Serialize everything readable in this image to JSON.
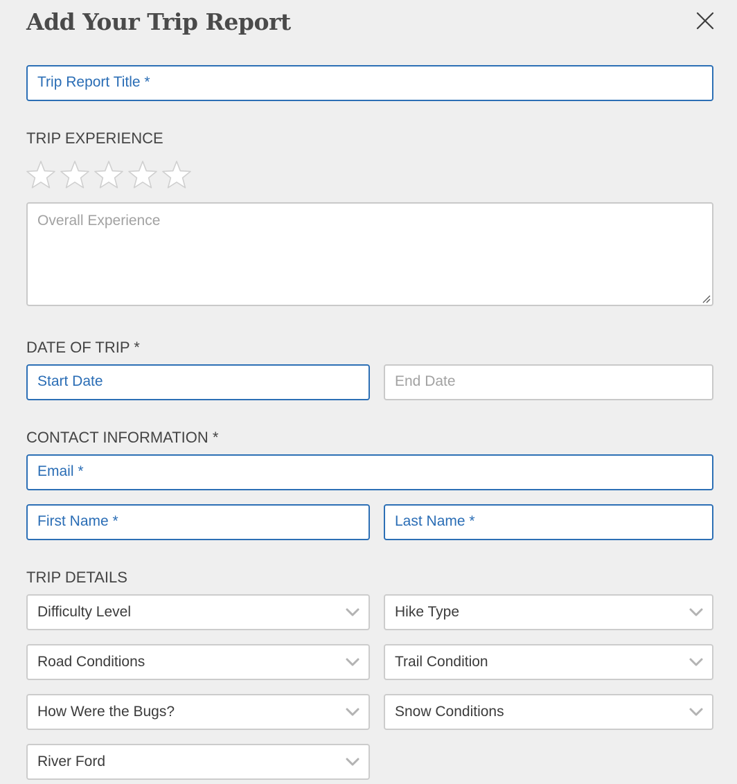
{
  "header": {
    "title": "Add Your Trip Report",
    "close_icon": "close-icon"
  },
  "fields": {
    "trip_title_placeholder": "Trip Report Title *",
    "overall_experience_placeholder": "Overall Experience",
    "start_date_placeholder": "Start Date",
    "end_date_placeholder": "End Date",
    "email_placeholder": "Email *",
    "first_name_placeholder": "First Name *",
    "last_name_placeholder": "Last Name *"
  },
  "sections": {
    "trip_experience": "TRIP EXPERIENCE",
    "date_of_trip": "DATE OF TRIP *",
    "contact_information": "CONTACT INFORMATION *",
    "trip_details": "TRIP DETAILS"
  },
  "rating": {
    "max_stars": 5,
    "selected": 0,
    "star_icon": "star-outline-icon"
  },
  "trip_details": {
    "difficulty_level": "Difficulty Level",
    "hike_type": "Hike Type",
    "road_conditions": "Road Conditions",
    "trail_condition": "Trail Condition",
    "bugs": "How Were the Bugs?",
    "snow_conditions": "Snow Conditions",
    "river_ford": "River Ford",
    "chevron_icon": "chevron-down-icon"
  },
  "colors": {
    "background": "#efefef",
    "accent_blue": "#2c6fb5",
    "muted_border": "#c9c9c9",
    "placeholder_gray": "#a2a2a2",
    "heading_gray": "#4a4a4a"
  }
}
